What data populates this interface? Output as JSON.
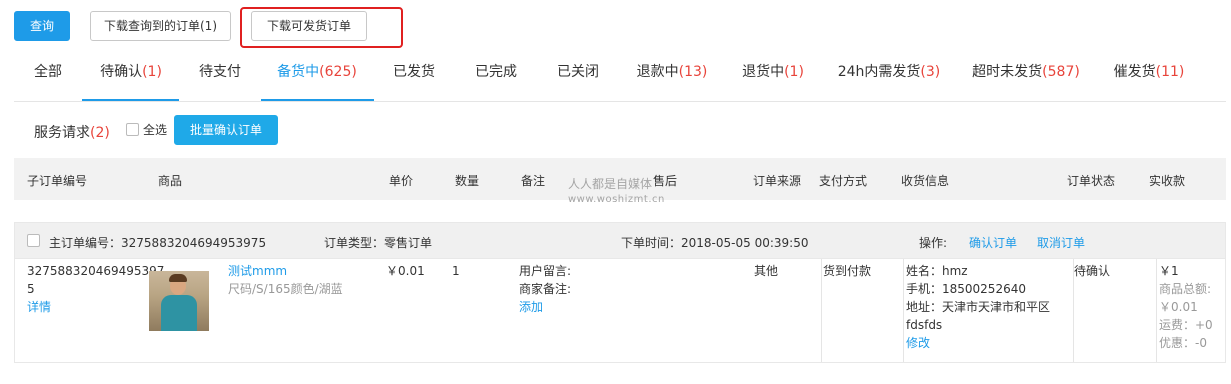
{
  "toolbar": {
    "query_label": "查询",
    "download_queried_label": "下载查询到的订单(1)",
    "download_shippable_label": "下载可发货订单"
  },
  "tabs": [
    {
      "label": "全部",
      "count": ""
    },
    {
      "label": "待确认",
      "count": "(1)"
    },
    {
      "label": "待支付",
      "count": ""
    },
    {
      "label": "备货中",
      "count": "(625)"
    },
    {
      "label": "已发货",
      "count": ""
    },
    {
      "label": "已完成",
      "count": ""
    },
    {
      "label": "已关闭",
      "count": ""
    },
    {
      "label": "退款中",
      "count": "(13)"
    },
    {
      "label": "退货中",
      "count": "(1)"
    },
    {
      "label": "24h内需发货",
      "count": "(3)"
    },
    {
      "label": "超时未发货",
      "count": "(587)"
    },
    {
      "label": "催发货",
      "count": "(11)"
    }
  ],
  "service": {
    "label": "服务请求",
    "count": "(2)",
    "select_all_label": "全选",
    "batch_confirm_label": "批量确认订单"
  },
  "table": {
    "headers": {
      "sub_order_no": "子订单编号",
      "product": "商品",
      "unit_price": "单价",
      "quantity": "数量",
      "remark": "备注",
      "after_sale": "售后",
      "order_source": "订单来源",
      "payment": "支付方式",
      "shipping_info": "收货信息",
      "order_status": "订单状态",
      "received": "实收款"
    }
  },
  "watermark": {
    "line1": "人人都是自媒体",
    "line2": "www.woshizmt.cn"
  },
  "order": {
    "main_no_label": "主订单编号：",
    "main_no": "3275883204694953975",
    "type_label": "订单类型：",
    "type": "零售订单",
    "time_label": "下单时间：",
    "time": "2018-05-05 00:39:50",
    "ops_label": "操作:",
    "confirm_label": "确认订单",
    "cancel_label": "取消订单",
    "sub_no_line1": "327588320469495397",
    "sub_no_line2": "5",
    "detail_label": "详情",
    "product_name": "测试mmm",
    "product_spec": "尺码/S/165颜色/湖蓝",
    "unit_price": "￥0.01",
    "quantity": "1",
    "user_msg_label": "用户留言:",
    "merchant_note_label": "商家备注:",
    "add_label": "添加",
    "source": "其他",
    "payment": "货到付款",
    "name_line": "姓名：hmz",
    "phone_line": "手机：18500252640",
    "addr_line": "地址：天津市天津市和平区",
    "addr_line2": "fdsfds",
    "edit_label": "修改",
    "status": "待确认",
    "received": "￥1",
    "goods_total_label": "商品总额:",
    "goods_total": "￥0.01",
    "shipping_fee": "运费：+0",
    "discount": "优惠：-0"
  },
  "colors": {
    "accent": "#1e9be8",
    "count_red": "#e8443b",
    "highlight_box": "#e02020"
  }
}
